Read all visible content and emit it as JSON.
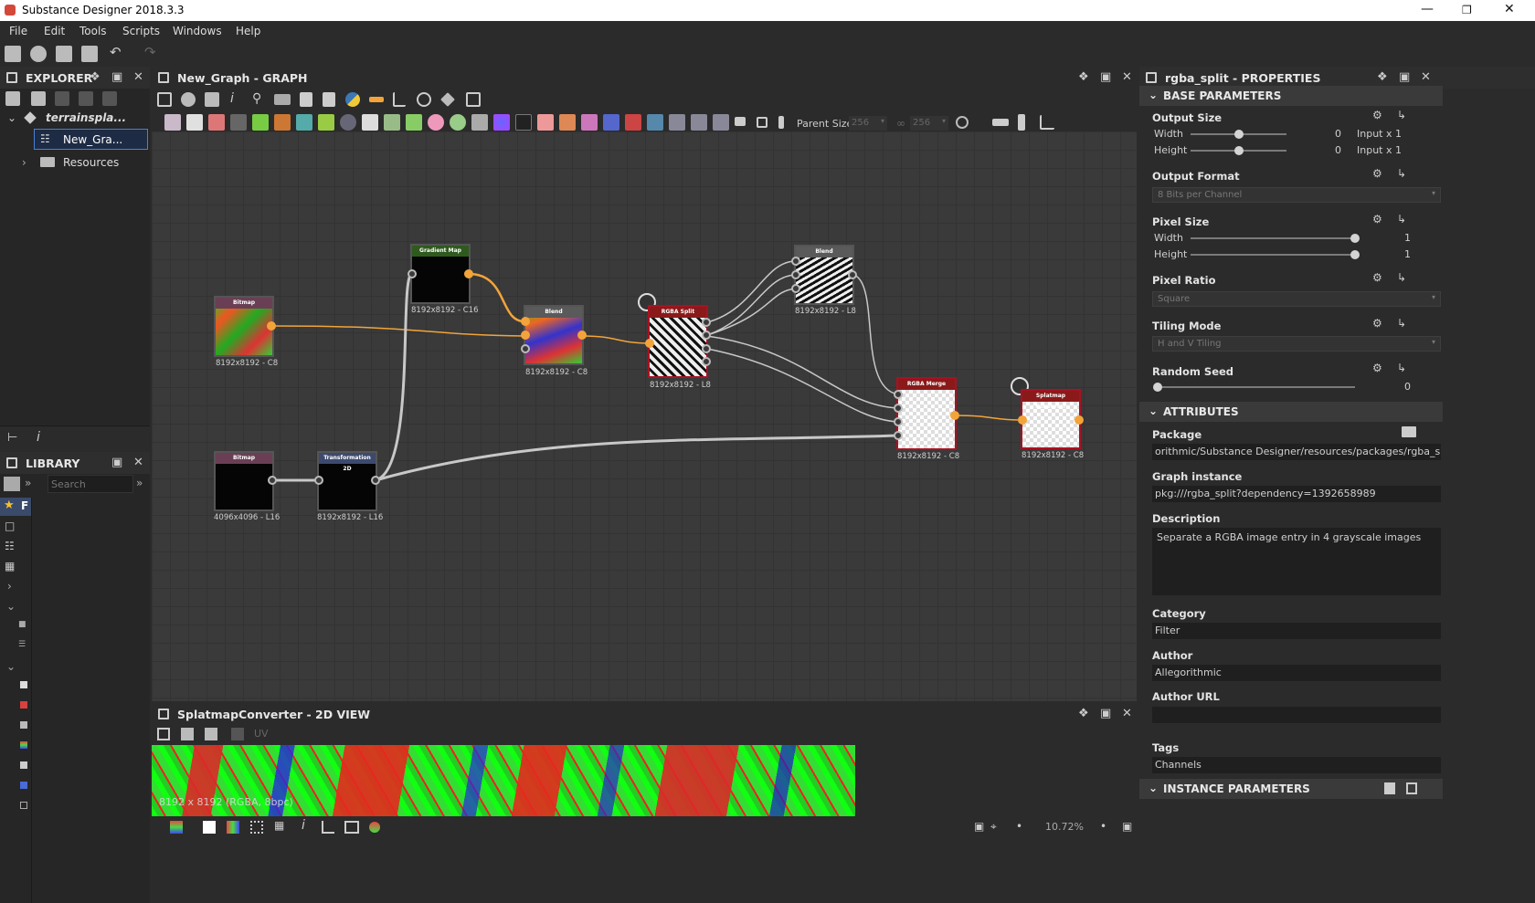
{
  "window": {
    "title": "Substance Designer 2018.3.3"
  },
  "menu": [
    "File",
    "Edit",
    "Tools",
    "Scripts",
    "Windows",
    "Help"
  ],
  "explorer": {
    "title": "EXPLORER",
    "package": "terrainspla...",
    "graph": "New_Gra...",
    "resources": "Resources"
  },
  "library": {
    "title": "LIBRARY",
    "search_placeholder": "Search"
  },
  "graph": {
    "title": "New_Graph - GRAPH",
    "parent_size_label": "Parent Size:",
    "parent_size_value": "256",
    "parent_size_value2": "256",
    "nodes": {
      "bitmap1": {
        "title": "Bitmap",
        "label": "8192x8192 - C8"
      },
      "gradient_map": {
        "title": "Gradient Map",
        "label": "8192x8192 - C16"
      },
      "blend1": {
        "title": "Blend",
        "label": "8192x8192 - C8"
      },
      "rgba_split": {
        "title": "RGBA Split",
        "label": "8192x8192 - L8"
      },
      "blend2": {
        "title": "Blend",
        "label": "8192x8192 - L8"
      },
      "rgba_merge": {
        "title": "RGBA Merge",
        "label": "8192x8192 - C8"
      },
      "splatmap": {
        "title": "Splatmap Converter",
        "label": "8192x8192 - C8"
      },
      "bitmap2": {
        "title": "Bitmap",
        "label": "4096x4096 - L16"
      },
      "transform2d": {
        "title": "Transformation 2D",
        "label": "8192x8192 - L16"
      }
    },
    "colors": {
      "bitmap": "#6a3f55",
      "gradient": "#2f5a1e",
      "blend": "#5a5a5a",
      "split": "#8a1a1a",
      "transform": "#3d4a6e",
      "wire_active": "#f2a43a",
      "wire": "#c8c8c8"
    }
  },
  "view2d": {
    "title": "SplatmapConverter - 2D VIEW",
    "uv": "UV",
    "info": "8192 x 8192 (RGBA, 8bpc)",
    "zoom": "10.72%"
  },
  "properties": {
    "title": "rgba_split - PROPERTIES",
    "base_section": "BASE PARAMETERS",
    "output_size": {
      "label": "Output Size",
      "width_label": "Width",
      "height_label": "Height",
      "width_value": "0",
      "height_value": "0",
      "width_mode": "Input x 1",
      "height_mode": "Input x 1",
      "width_fraction": 0.5,
      "height_fraction": 0.5
    },
    "output_format": {
      "label": "Output Format",
      "value": "8 Bits per Channel"
    },
    "pixel_size": {
      "label": "Pixel Size",
      "width_label": "Width",
      "height_label": "Height",
      "width_value": "1",
      "height_value": "1",
      "width_fraction": 1.0,
      "height_fraction": 1.0
    },
    "pixel_ratio": {
      "label": "Pixel Ratio",
      "value": "Square"
    },
    "tiling_mode": {
      "label": "Tiling Mode",
      "value": "H and V Tiling"
    },
    "random_seed": {
      "label": "Random Seed",
      "value": "0",
      "fraction": 0.0
    },
    "attributes_section": "ATTRIBUTES",
    "package": {
      "label": "Package",
      "value": "orithmic/Substance Designer/resources/packages/rgba_split.sbs"
    },
    "graph_instance": {
      "label": "Graph instance",
      "value": "pkg:///rgba_split?dependency=1392658989"
    },
    "description": {
      "label": "Description",
      "value": "Separate a RGBA image entry in 4 grayscale images"
    },
    "category": {
      "label": "Category",
      "value": "Filter"
    },
    "author": {
      "label": "Author",
      "value": "Allegorithmic"
    },
    "author_url": {
      "label": "Author URL",
      "value": ""
    },
    "tags": {
      "label": "Tags",
      "value": "Channels"
    },
    "instance_section": "INSTANCE PARAMETERS"
  }
}
